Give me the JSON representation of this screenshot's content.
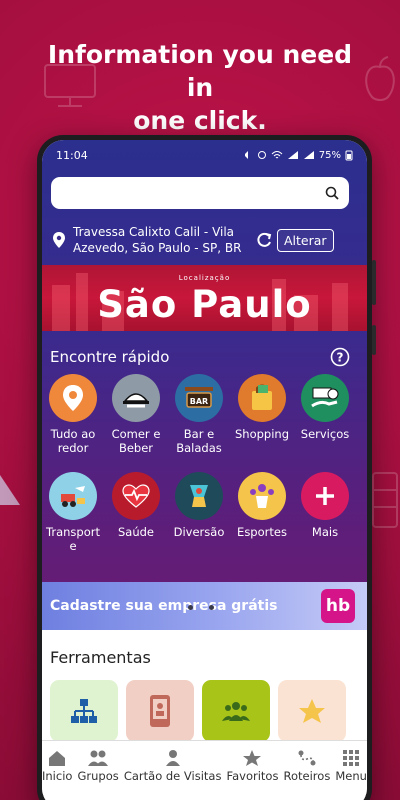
{
  "promo": {
    "line1": "Information you need in",
    "line2": "one click."
  },
  "status": {
    "time": "11:04",
    "battery": "75%",
    "net1": "VoLTE LTE1",
    "net2": "VoLTE LTE2"
  },
  "search": {
    "placeholder": "",
    "icon": "search-icon"
  },
  "location": {
    "address_line1": "Travessa Calixto Calil - Vila",
    "address_line2": "Azevedo, São Paulo - SP, BR",
    "change_button": "Alterar"
  },
  "city": {
    "caption": "Localização",
    "name": "São Paulo"
  },
  "quick_find": {
    "title": "Encontre rápido",
    "items": [
      {
        "line1": "Tudo ao",
        "line2": "redor",
        "icon": "location-pin-icon",
        "color": "#f0883c"
      },
      {
        "line1": "Comer e",
        "line2": "Beber",
        "icon": "food-service-icon",
        "color": "#8e9aa6"
      },
      {
        "line1": "Bar e",
        "line2": "Baladas",
        "icon": "bar-sign-icon",
        "color": "#2c6da3"
      },
      {
        "line1": "Shopping",
        "line2": "",
        "icon": "shopping-bag-icon",
        "color": "#e07a2c"
      },
      {
        "line1": "Serviços",
        "line2": "",
        "icon": "services-icon",
        "color": "#1f8f5f"
      },
      {
        "line1": "Transport",
        "line2": "e",
        "icon": "transport-icon",
        "color": "#8fd2e8"
      },
      {
        "line1": "Saúde",
        "line2": "",
        "icon": "health-heart-icon",
        "color": "#b81c2c"
      },
      {
        "line1": "Diversão",
        "line2": "",
        "icon": "fun-icon",
        "color": "#1f4a5a"
      },
      {
        "line1": "Esportes",
        "line2": "",
        "icon": "sports-icon",
        "color": "#f5c44a"
      },
      {
        "line1": "Mais",
        "line2": "",
        "icon": "plus-icon",
        "color": "#d81b60"
      }
    ]
  },
  "ad": {
    "text": "Cadastre sua empresa grátis",
    "logo_text": "hb"
  },
  "tools": {
    "title": "Ferramentas",
    "items": [
      {
        "icon": "org-chart-icon",
        "color": "#dff3d0"
      },
      {
        "icon": "phone-card-icon",
        "color": "#f2cfc4"
      },
      {
        "icon": "group-icon",
        "color": "#a8c418"
      },
      {
        "icon": "star-icon",
        "color": "#fbe3d3"
      }
    ]
  },
  "nav": {
    "items": [
      {
        "label": "Inicio",
        "icon": "home-icon"
      },
      {
        "label": "Grupos",
        "icon": "groups-icon"
      },
      {
        "label": "Cartão de Visitas",
        "icon": "person-icon"
      },
      {
        "label": "Favoritos",
        "icon": "star-icon"
      },
      {
        "label": "Roteiros",
        "icon": "route-icon"
      },
      {
        "label": "Menu",
        "icon": "grid-menu-icon"
      }
    ]
  }
}
